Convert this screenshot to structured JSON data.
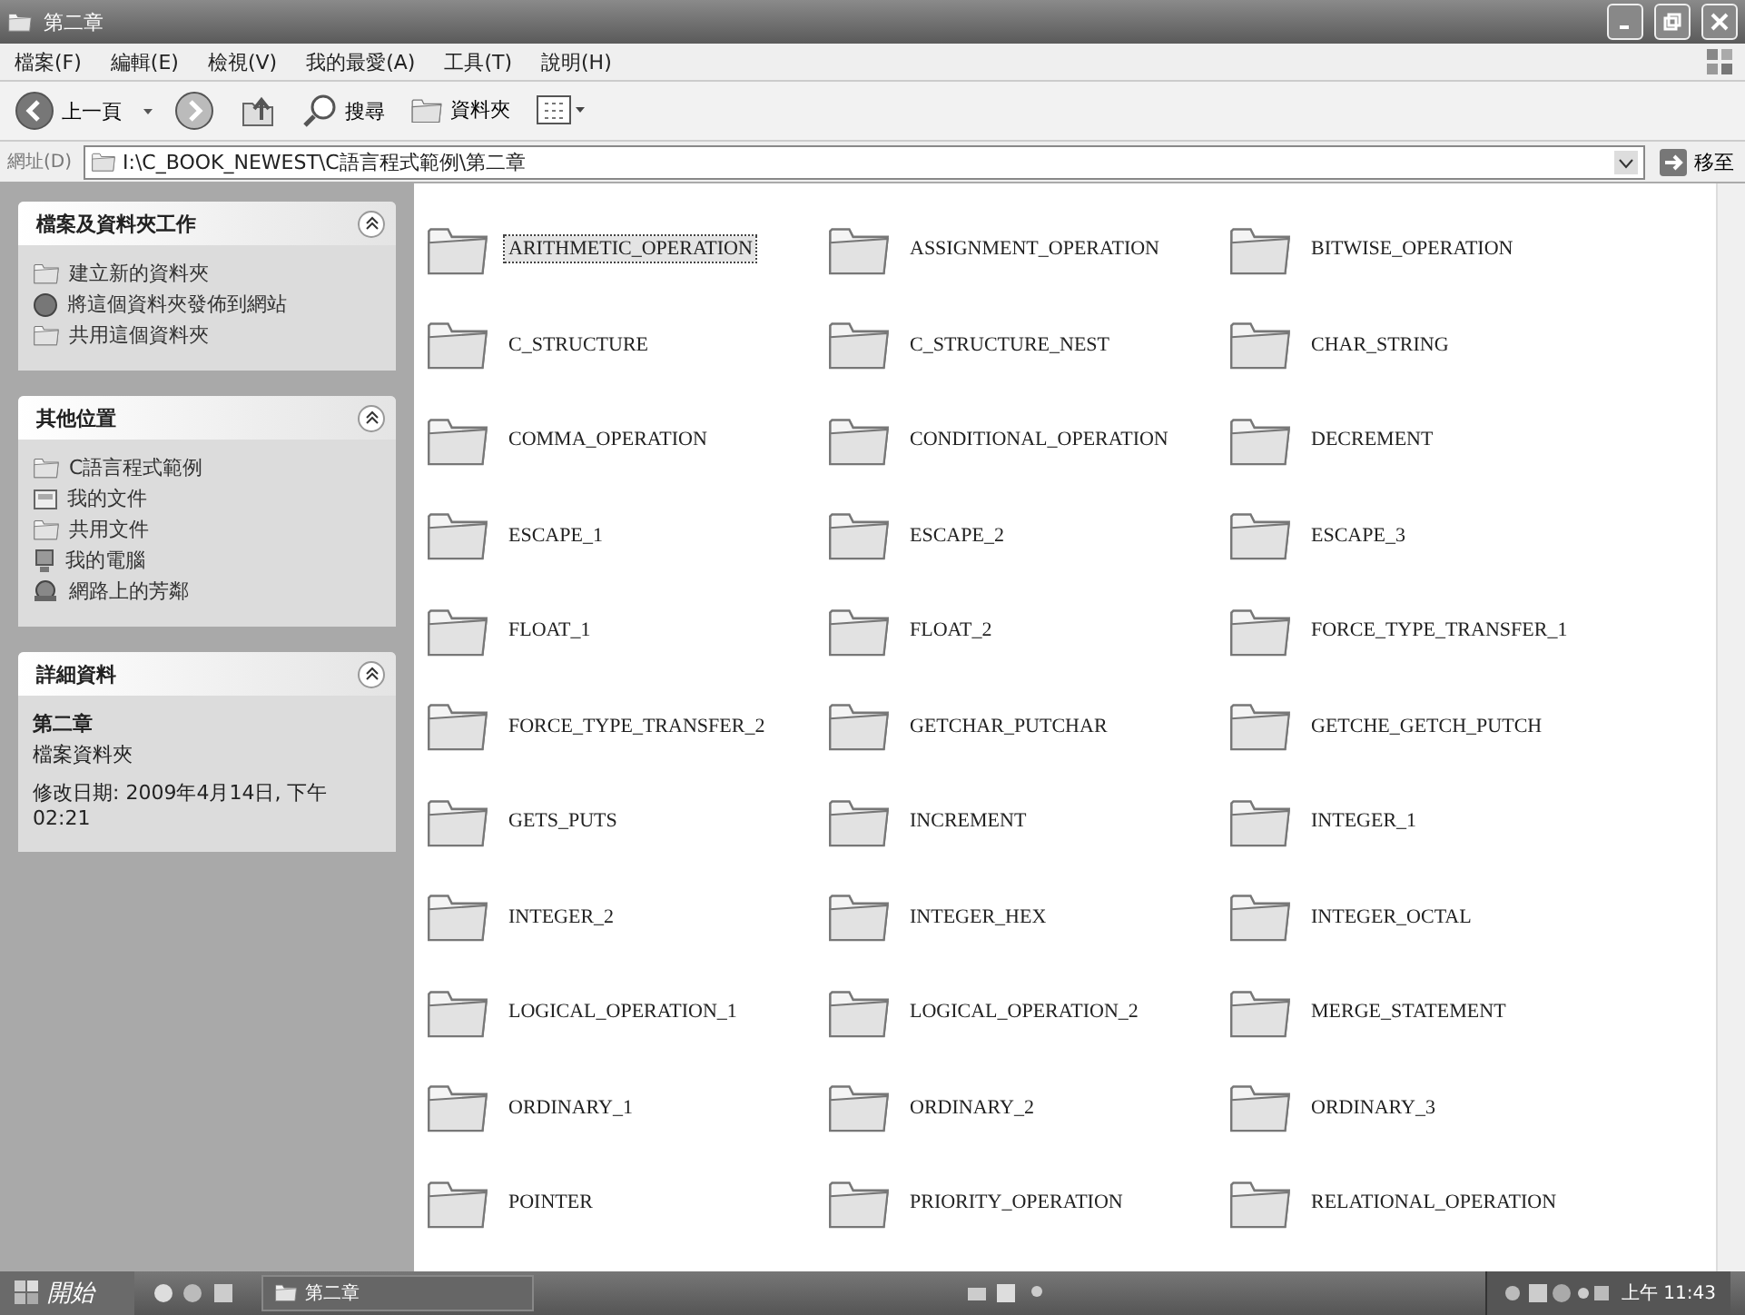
{
  "window": {
    "title": "第二章"
  },
  "menu": [
    "檔案(F)",
    "編輯(E)",
    "檢視(V)",
    "我的最愛(A)",
    "工具(T)",
    "說明(H)"
  ],
  "toolbar": {
    "back": "上一頁",
    "search": "搜尋",
    "folders": "資料夾"
  },
  "address": {
    "label": "網址(D)",
    "value": "I:\\C_BOOK_NEWEST\\C語言程式範例\\第二章",
    "go": "移至"
  },
  "sidebar": [
    {
      "title": "檔案及資料夾工作",
      "expanded": true,
      "items": [
        {
          "label": "建立新的資料夾",
          "kind": "folder"
        },
        {
          "label": "將這個資料夾發佈到網站",
          "kind": "globe"
        },
        {
          "label": "共用這個資料夾",
          "kind": "folder"
        }
      ]
    },
    {
      "title": "其他位置",
      "expanded": true,
      "items": [
        {
          "label": "C語言程式範例",
          "kind": "folder"
        },
        {
          "label": "我的文件",
          "kind": "documents"
        },
        {
          "label": "共用文件",
          "kind": "folder"
        },
        {
          "label": "我的電腦",
          "kind": "computer"
        },
        {
          "label": "網路上的芳鄰",
          "kind": "network"
        }
      ]
    },
    {
      "title": "詳細資料",
      "expanded": true,
      "details": {
        "name": "第二章",
        "type": "檔案資料夾",
        "modified": "修改日期: 2009年4月14日, 下午 02:21"
      }
    }
  ],
  "folders": [
    {
      "name": "ARITHMETIC_OPERATION",
      "selected": true
    },
    {
      "name": "ASSIGNMENT_OPERATION",
      "selected": false
    },
    {
      "name": "BITWISE_OPERATION",
      "selected": false
    },
    {
      "name": "C_STRUCTURE",
      "selected": false
    },
    {
      "name": "C_STRUCTURE_NEST",
      "selected": false
    },
    {
      "name": "CHAR_STRING",
      "selected": false
    },
    {
      "name": "COMMA_OPERATION",
      "selected": false
    },
    {
      "name": "CONDITIONAL_OPERATION",
      "selected": false
    },
    {
      "name": "DECREMENT",
      "selected": false
    },
    {
      "name": "ESCAPE_1",
      "selected": false
    },
    {
      "name": "ESCAPE_2",
      "selected": false
    },
    {
      "name": "ESCAPE_3",
      "selected": false
    },
    {
      "name": "FLOAT_1",
      "selected": false
    },
    {
      "name": "FLOAT_2",
      "selected": false
    },
    {
      "name": "FORCE_TYPE_TRANSFER_1",
      "selected": false
    },
    {
      "name": "FORCE_TYPE_TRANSFER_2",
      "selected": false
    },
    {
      "name": "GETCHAR_PUTCHAR",
      "selected": false
    },
    {
      "name": "GETCHE_GETCH_PUTCH",
      "selected": false
    },
    {
      "name": "GETS_PUTS",
      "selected": false
    },
    {
      "name": "INCREMENT",
      "selected": false
    },
    {
      "name": "INTEGER_1",
      "selected": false
    },
    {
      "name": "INTEGER_2",
      "selected": false
    },
    {
      "name": "INTEGER_HEX",
      "selected": false
    },
    {
      "name": "INTEGER_OCTAL",
      "selected": false
    },
    {
      "name": "LOGICAL_OPERATION_1",
      "selected": false
    },
    {
      "name": "LOGICAL_OPERATION_2",
      "selected": false
    },
    {
      "name": "MERGE_STATEMENT",
      "selected": false
    },
    {
      "name": "ORDINARY_1",
      "selected": false
    },
    {
      "name": "ORDINARY_2",
      "selected": false
    },
    {
      "name": "ORDINARY_3",
      "selected": false
    },
    {
      "name": "POINTER",
      "selected": false
    },
    {
      "name": "PRIORITY_OPERATION",
      "selected": false
    },
    {
      "name": "RELATIONAL_OPERATION",
      "selected": false
    }
  ],
  "taskbar": {
    "start": "開始",
    "window": "第二章",
    "clock": "上午 11:43"
  }
}
